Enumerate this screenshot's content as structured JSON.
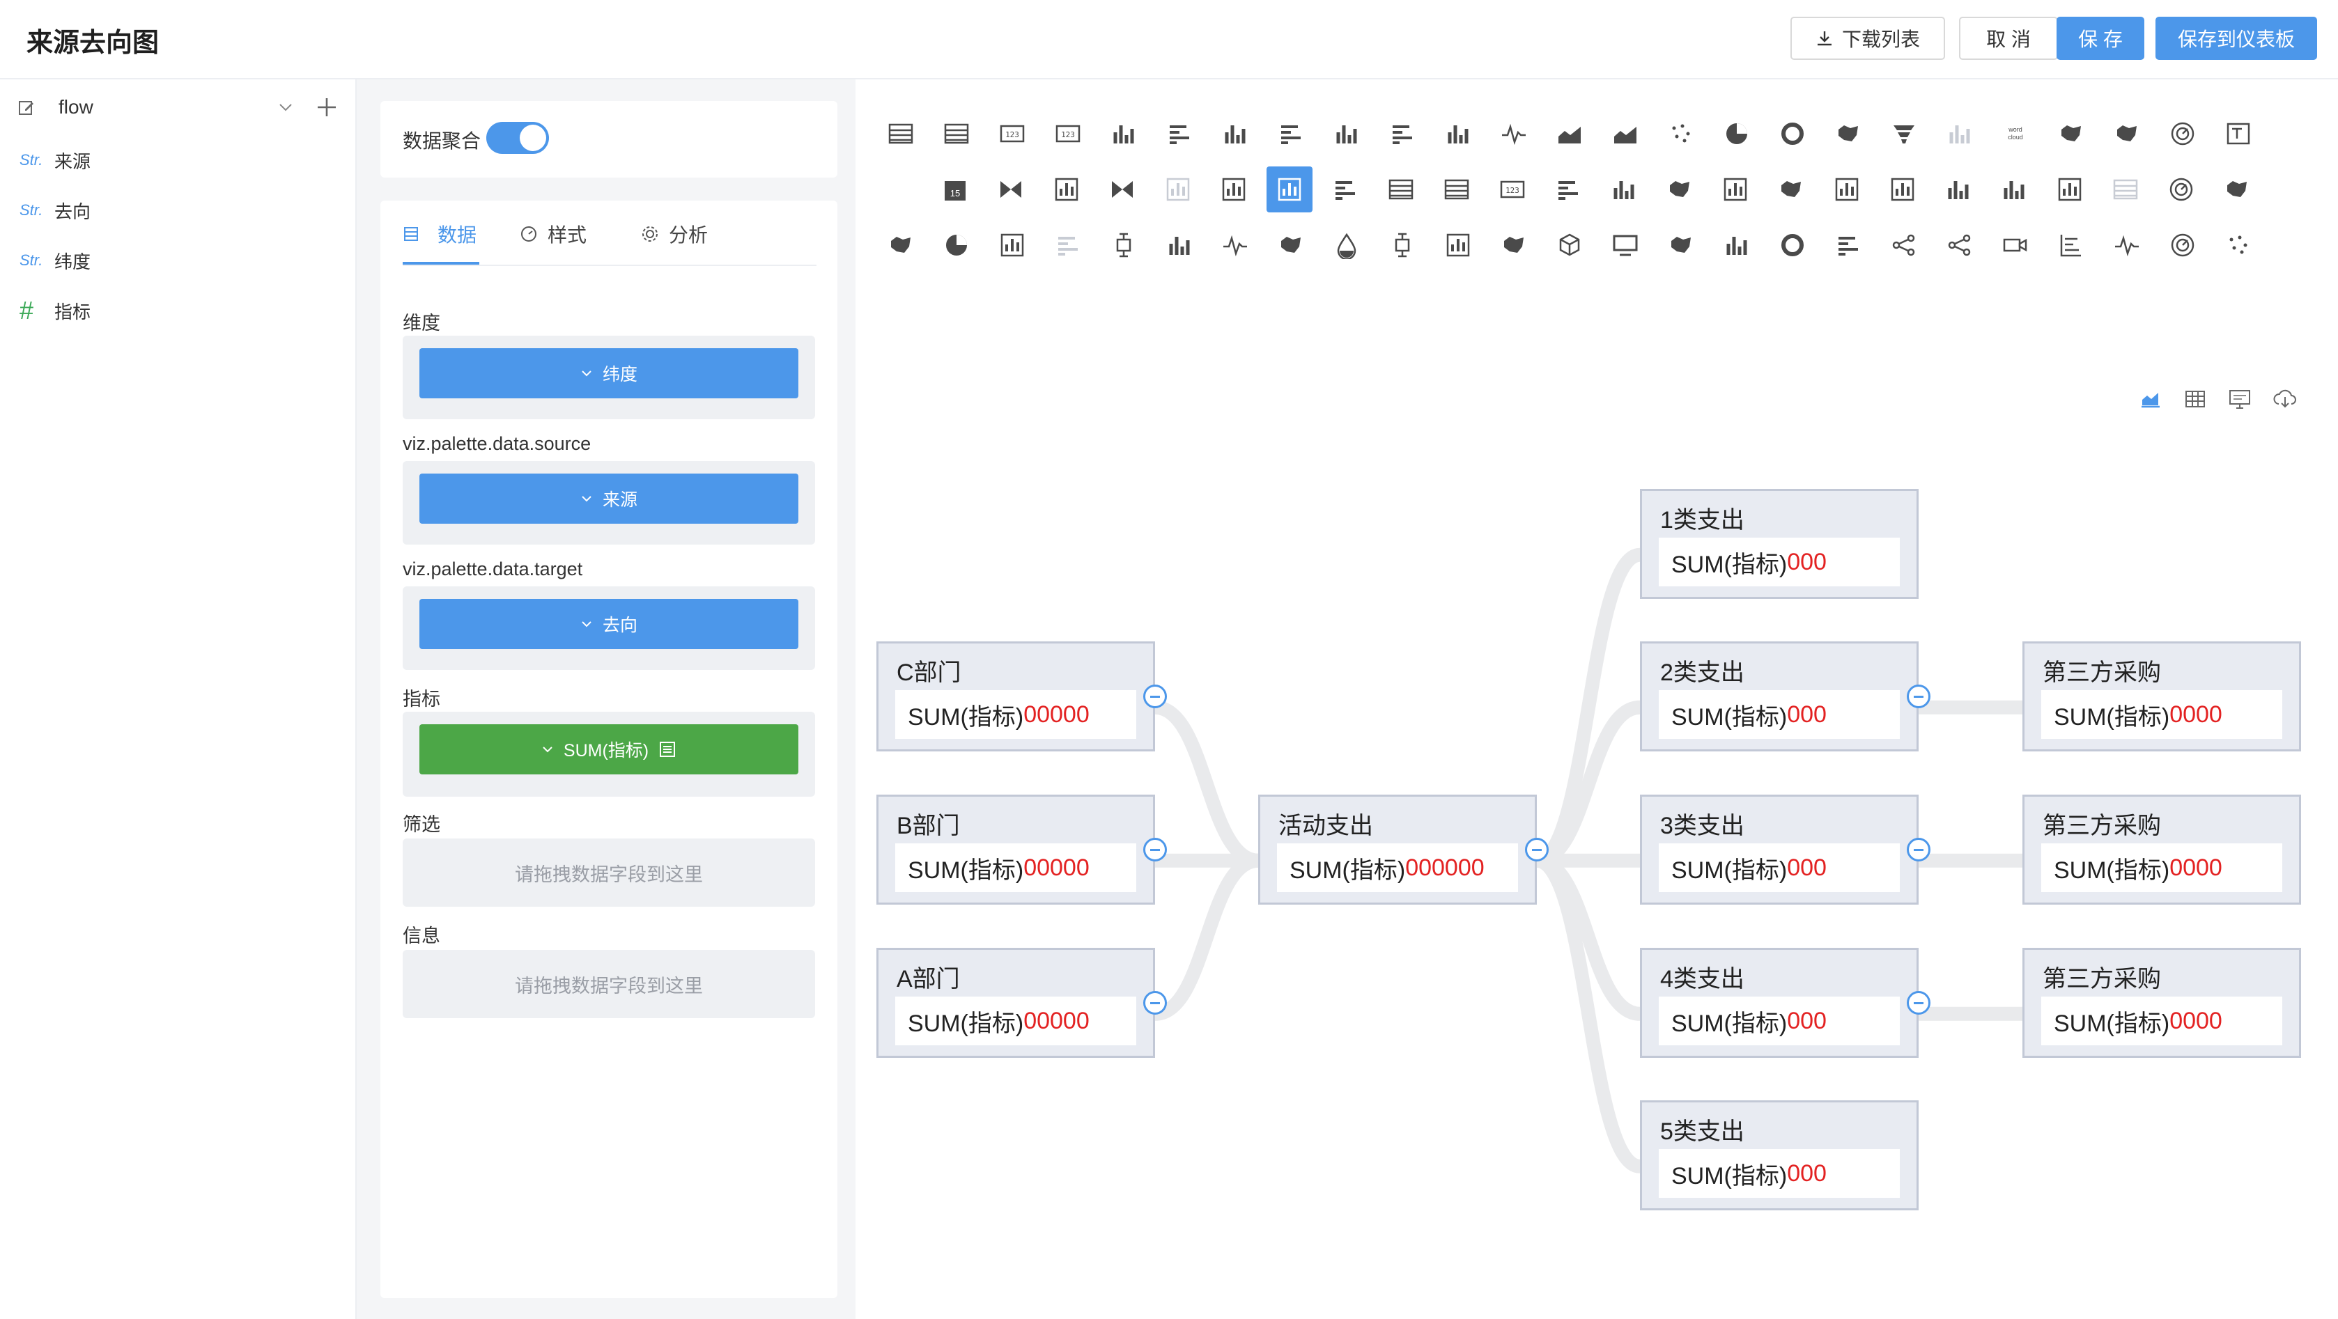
{
  "header": {
    "title": "来源去向图",
    "download_label": "下载列表",
    "cancel_label": "取 消",
    "save_label": "保 存",
    "save_dashboard_label": "保存到仪表板"
  },
  "sidebar": {
    "dataset": "flow",
    "fields": [
      {
        "type": "Str.",
        "label": "来源"
      },
      {
        "type": "Str.",
        "label": "去向"
      },
      {
        "type": "Str.",
        "label": "纬度"
      },
      {
        "type": "#",
        "label": "指标"
      }
    ]
  },
  "config": {
    "aggregate_label": "数据聚合",
    "aggregate_on": true,
    "tabs": [
      {
        "label": "数据",
        "icon": "table-icon",
        "active": true
      },
      {
        "label": "样式",
        "icon": "palette-icon",
        "active": false
      },
      {
        "label": "分析",
        "icon": "gear-icon",
        "active": false
      }
    ],
    "sections": {
      "dimension_label": "维度",
      "dimension_value": "纬度",
      "source_label": "viz.palette.data.source",
      "source_value": "来源",
      "target_label": "viz.palette.data.target",
      "target_value": "去向",
      "metric_label": "指标",
      "metric_value": "SUM(指标)",
      "filter_label": "筛选",
      "filter_placeholder": "请拖拽数据字段到这里",
      "info_label": "信息",
      "info_placeholder": "请拖拽数据字段到这里"
    }
  },
  "palette": {
    "selected_index": 31,
    "icons": [
      "table-icon",
      "pivot-table-icon",
      "number-card-icon",
      "number-card-icon",
      "bar-chart-icon",
      "horizontal-bar-icon",
      "grouped-bar-icon",
      "stacked-horizontal-bar-icon",
      "percent-bar-icon",
      "percent-horizontal-bar-icon",
      "waterfall-icon",
      "line-chart-icon",
      "area-chart-icon",
      "stacked-area-icon",
      "scatter-icon",
      "pie-chart-icon",
      "donut-chart-icon",
      "rose-chart-icon",
      "funnel-icon",
      "bar-disabled-icon",
      "word-cloud-icon",
      "china-map-icon",
      "world-map-icon",
      "gauge-icon",
      "rich-text-icon",
      "calendar-icon",
      "sankey-icon",
      "chart-icon",
      "butterfly-icon",
      "chart-disabled-icon",
      "chart-icon",
      "chart-disabled-icon",
      "horizontal-bar-icon",
      "table-icon",
      "list-icon",
      "number-card-icon",
      "horizontal-bar-icon",
      "bar-chart-icon",
      "china-map-icon",
      "chart-icon",
      "world-map-icon",
      "chart-icon",
      "chart-icon",
      "bar-chart-icon",
      "percent-bar-icon",
      "chart-icon",
      "list-disabled-icon",
      "radar-icon",
      "map-icon",
      "region-map-icon",
      "pie-chart-icon",
      "chart-icon",
      "horizontal-bar-disabled-icon",
      "boxplot-icon",
      "column-icon",
      "pulse-line-icon",
      "map-pin-icon",
      "liquid-icon",
      "dumbbell-icon",
      "chart-icon",
      "heatmap-icon",
      "cube-3d-icon",
      "monitor-icon",
      "treemap-icon",
      "histogram-icon",
      "progress-ring-icon",
      "gantt-icon",
      "graph-network-icon",
      "link-icon",
      "video-icon",
      "tree-icon",
      "pulse-line-icon",
      "polar-icon",
      "scatter-dots-icon"
    ]
  },
  "chart_tools": [
    "chart-view-icon",
    "table-view-icon",
    "sql-view-icon",
    "download-icon"
  ],
  "chart_data": {
    "type": "sankey",
    "metric": "SUM(指标)",
    "nodes": [
      {
        "id": "c",
        "name": "C部门",
        "label": "SUM(指标)",
        "value": "00000",
        "collapsible": true
      },
      {
        "id": "b",
        "name": "B部门",
        "label": "SUM(指标)",
        "value": "00000",
        "collapsible": true
      },
      {
        "id": "a",
        "name": "A部门",
        "label": "SUM(指标)",
        "value": "00000",
        "collapsible": true
      },
      {
        "id": "hub",
        "name": "活动支出",
        "label": "SUM(指标)",
        "value": "000000",
        "collapsible": true
      },
      {
        "id": "t1",
        "name": "1类支出",
        "label": "SUM(指标)",
        "value": "000",
        "collapsible": false
      },
      {
        "id": "t2",
        "name": "2类支出",
        "label": "SUM(指标)",
        "value": "000",
        "collapsible": true
      },
      {
        "id": "t3",
        "name": "3类支出",
        "label": "SUM(指标)",
        "value": "000",
        "collapsible": true
      },
      {
        "id": "t4",
        "name": "4类支出",
        "label": "SUM(指标)",
        "value": "000",
        "collapsible": true
      },
      {
        "id": "t5",
        "name": "5类支出",
        "label": "SUM(指标)",
        "value": "000",
        "collapsible": false
      },
      {
        "id": "p2",
        "name": "第三方采购",
        "label": "SUM(指标)",
        "value": "0000",
        "collapsible": false
      },
      {
        "id": "p3",
        "name": "第三方采购",
        "label": "SUM(指标)",
        "value": "0000",
        "collapsible": false
      },
      {
        "id": "p4",
        "name": "第三方采购",
        "label": "SUM(指标)",
        "value": "0000",
        "collapsible": false
      }
    ],
    "links": [
      {
        "source": "c",
        "target": "hub"
      },
      {
        "source": "b",
        "target": "hub"
      },
      {
        "source": "a",
        "target": "hub"
      },
      {
        "source": "hub",
        "target": "t1"
      },
      {
        "source": "hub",
        "target": "t2"
      },
      {
        "source": "hub",
        "target": "t3"
      },
      {
        "source": "hub",
        "target": "t4"
      },
      {
        "source": "hub",
        "target": "t5"
      },
      {
        "source": "t2",
        "target": "p2"
      },
      {
        "source": "t3",
        "target": "p3"
      },
      {
        "source": "t4",
        "target": "p4"
      }
    ]
  }
}
